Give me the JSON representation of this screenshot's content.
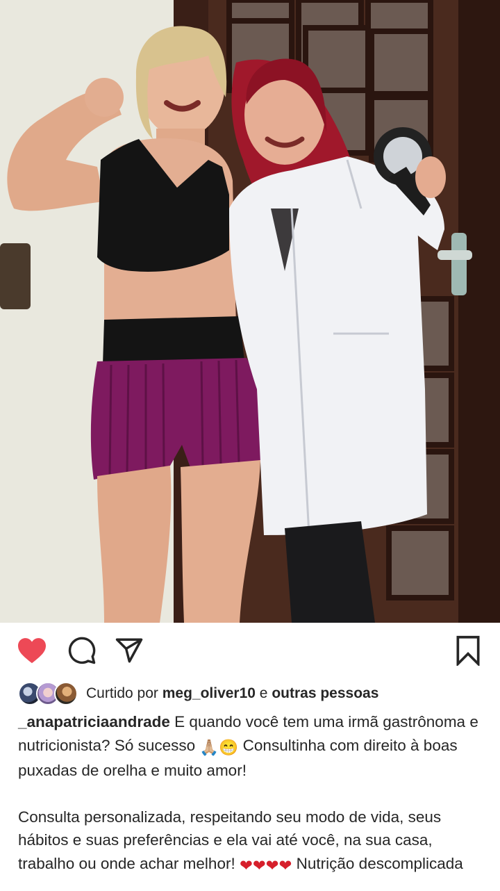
{
  "post": {
    "image_alt": "Duas mulheres sorrindo em frente a uma porta de madeira",
    "actions": {
      "like": "heart-filled-icon",
      "comment": "comment-icon",
      "share": "direct-share-icon",
      "save": "bookmark-icon"
    },
    "colors": {
      "like": "#ed4956",
      "text": "#262626"
    },
    "likes": {
      "prefix": "Curtido por ",
      "user": "meg_oliver10",
      "joiner": " e ",
      "others": "outras pessoas"
    },
    "caption": {
      "username": "_anapatriciaandrade",
      "line1": " E quando você tem uma irmã gastrônoma e nutricionista? Só sucesso ",
      "line1_emoji": "🙏🏼😁",
      "line1_rest": " Consultinha com direito à boas puxadas de orelha e muito amor!",
      "para2": "Consulta personalizada, respeitando seu modo de vida, seus hábitos e suas preferências e ela vai até você, na sua casa, trabalho ou onde achar melhor! ",
      "para2_hearts": "❤❤❤❤",
      "para2_end": " Nutrição descomplicada"
    }
  }
}
